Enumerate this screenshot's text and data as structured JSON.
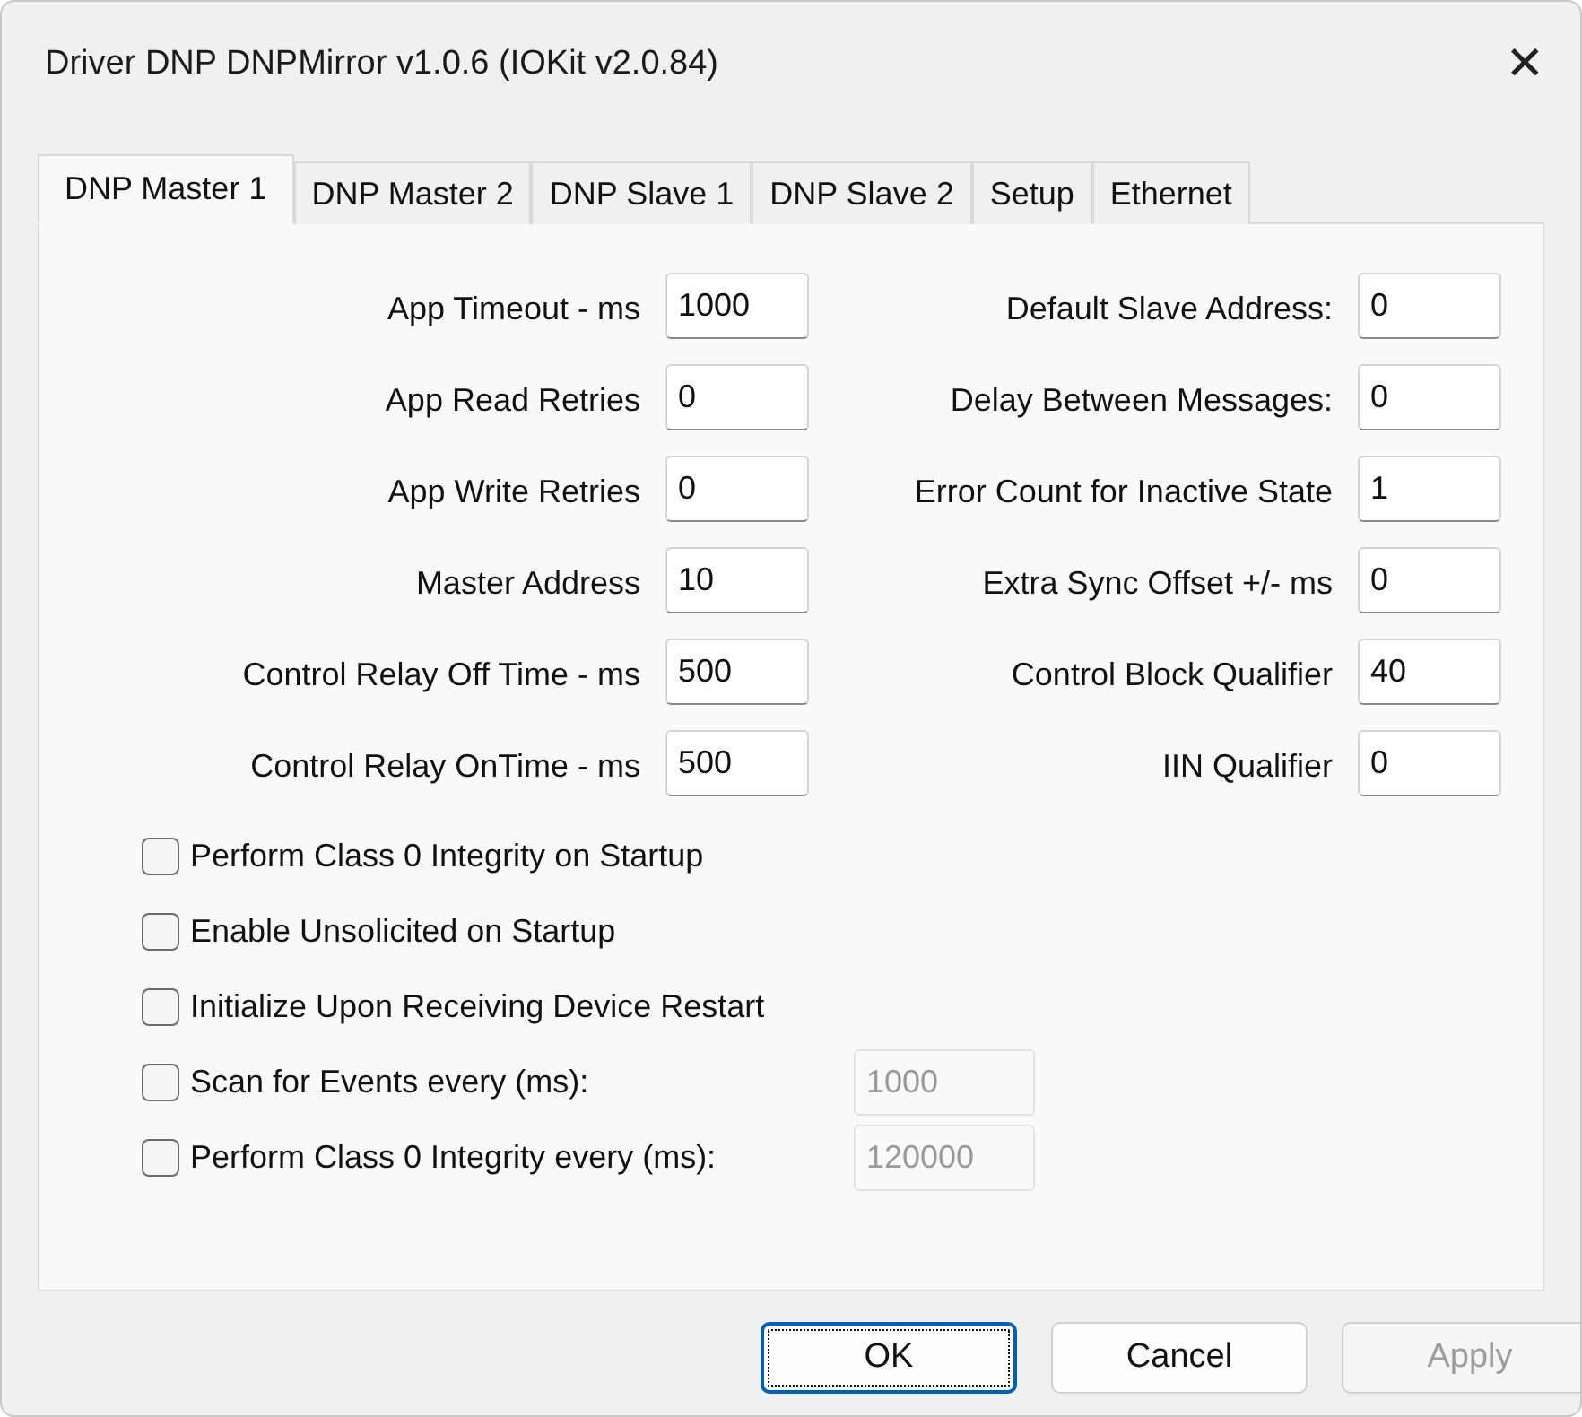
{
  "window": {
    "title": "Driver DNP DNPMirror v1.0.6 (IOKit v2.0.84)",
    "close": "✕"
  },
  "tabs": [
    {
      "label": "DNP Master 1",
      "selected": true
    },
    {
      "label": "DNP Master 2",
      "selected": false
    },
    {
      "label": "DNP Slave 1",
      "selected": false
    },
    {
      "label": "DNP Slave 2",
      "selected": false
    },
    {
      "label": "Setup",
      "selected": false
    },
    {
      "label": "Ethernet",
      "selected": false
    }
  ],
  "left_fields": [
    {
      "label": "App Timeout - ms",
      "value": "1000"
    },
    {
      "label": "App Read Retries",
      "value": "0"
    },
    {
      "label": "App Write Retries",
      "value": "0"
    },
    {
      "label": "Master Address",
      "value": "10"
    },
    {
      "label": "Control Relay Off Time - ms",
      "value": "500"
    },
    {
      "label": "Control Relay OnTime - ms",
      "value": "500"
    }
  ],
  "right_fields": [
    {
      "label": "Default Slave Address:",
      "value": "0"
    },
    {
      "label": "Delay Between Messages:",
      "value": "0"
    },
    {
      "label": "Error Count for Inactive State",
      "value": "1"
    },
    {
      "label": "Extra Sync Offset +/- ms",
      "value": "0"
    },
    {
      "label": "Control Block Qualifier",
      "value": "40"
    },
    {
      "label": "IIN Qualifier",
      "value": "0"
    }
  ],
  "options": [
    {
      "label": "Perform Class 0 Integrity on Startup",
      "checked": false
    },
    {
      "label": "Enable Unsolicited on Startup",
      "checked": false
    },
    {
      "label": "Initialize Upon Receiving Device Restart",
      "checked": false
    },
    {
      "label": "Scan for Events every (ms):",
      "checked": false,
      "interval": {
        "value": "1000",
        "disabled": true
      }
    },
    {
      "label": "Perform Class 0 Integrity every (ms):",
      "checked": false,
      "interval": {
        "value": "120000",
        "disabled": true
      }
    }
  ],
  "buttons": [
    {
      "label": "OK",
      "default": true,
      "disabled": false
    },
    {
      "label": "Cancel",
      "default": false,
      "disabled": false
    },
    {
      "label": "Apply",
      "default": false,
      "disabled": true
    }
  ]
}
